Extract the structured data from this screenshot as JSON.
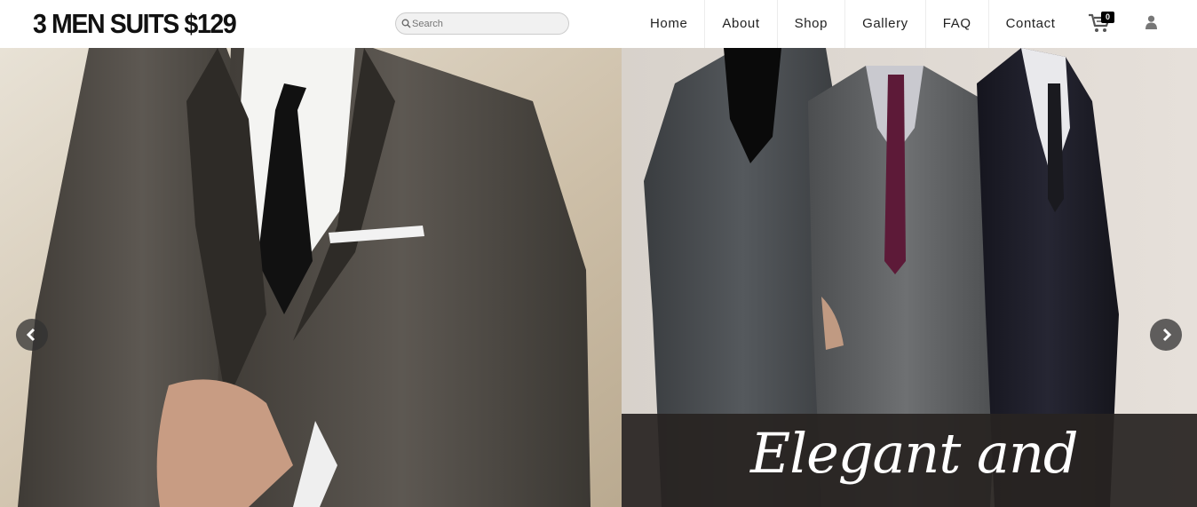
{
  "header": {
    "logo": "3 MEN SUITS $129",
    "search": {
      "placeholder": "Search",
      "value": ""
    },
    "nav": [
      {
        "label": "Home"
      },
      {
        "label": "About"
      },
      {
        "label": "Shop"
      },
      {
        "label": "Gallery"
      },
      {
        "label": "FAQ"
      },
      {
        "label": "Contact"
      }
    ],
    "cart_count": "0",
    "icons": {
      "search": "search-icon",
      "cart": "cart-icon",
      "user": "user-icon"
    }
  },
  "hero": {
    "caption": "Elegant and",
    "prev_icon": "chevron-left-icon",
    "next_icon": "chevron-right-icon",
    "colors": {
      "caption_bg": "#2a2521",
      "arrow_bg": "#333333"
    }
  }
}
